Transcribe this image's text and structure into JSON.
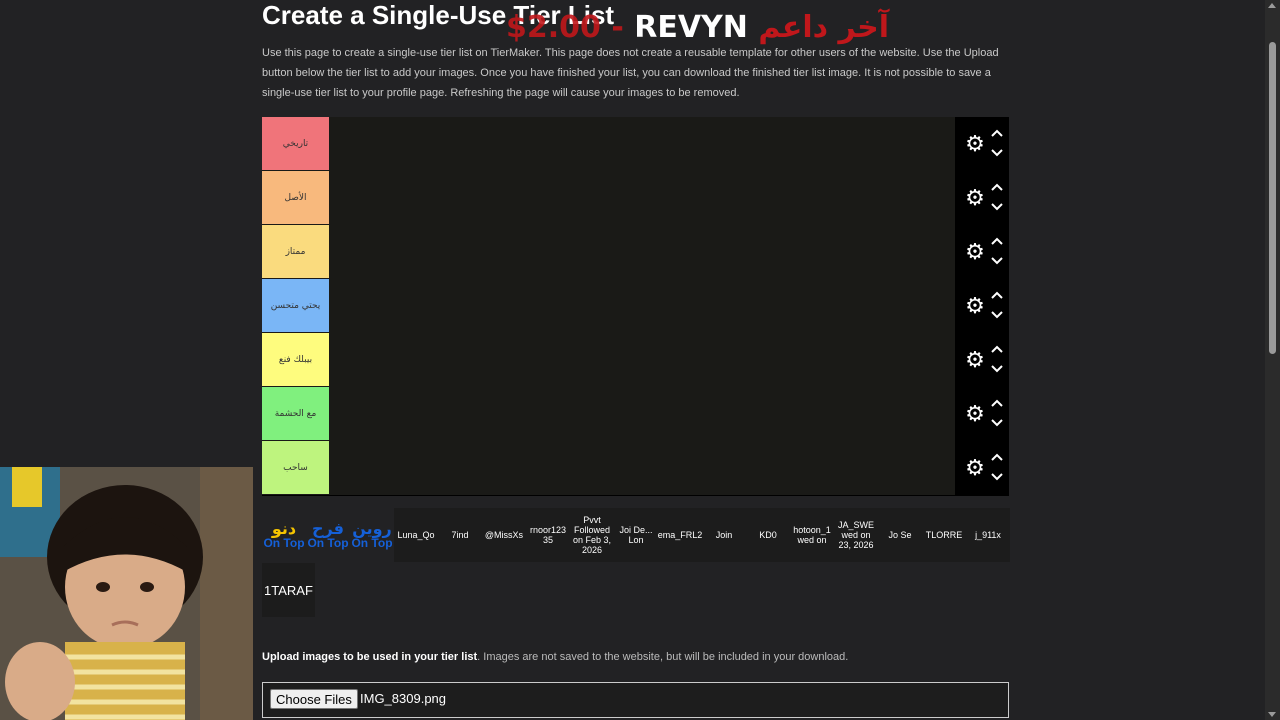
{
  "page": {
    "title": "Create a Single-Use Tier List",
    "intro": "Use this page to create a single-use tier list on TierMaker. This page does not create a reusable template for other users of the website. Use the Upload button below the tier list to add your images. Once you have finished your list, you can download the finished tier list image. It is not possible to save a single-use tier list to your profile page. Refreshing the page will cause your images to be removed."
  },
  "overlay": {
    "price": "$2.00 - ",
    "name": "REVYN",
    "arabic": "آخر داعم"
  },
  "tiers": [
    {
      "label": "تاريخي",
      "color": "#f0747a"
    },
    {
      "label": "الأصل",
      "color": "#f8b97d"
    },
    {
      "label": "ممتاز",
      "color": "#fadb7e"
    },
    {
      "label": "يحتي متحسن",
      "color": "#7ab6f6"
    },
    {
      "label": "بيبلك فنع",
      "color": "#fefc7e"
    },
    {
      "label": "مع الحشمة",
      "color": "#80f07e"
    },
    {
      "label": "ساحب",
      "color": "#bef47e"
    }
  ],
  "pool": [
    {
      "word": "دنو",
      "sub": "On Top",
      "word_color": "#f5c400"
    },
    {
      "word": "فرح",
      "sub": "On Top",
      "word_color": "#1560d8"
    },
    {
      "word": "روين",
      "sub": "On Top",
      "word_color": "#1560d8"
    },
    {
      "text": "Luna_Qo"
    },
    {
      "text": "7ind"
    },
    {
      "text": "@MissXs"
    },
    {
      "text": "rnoor123 35"
    },
    {
      "text": "Pvvt Followed on Feb 3, 2026"
    },
    {
      "text": "Joi De... Lon"
    },
    {
      "text": "eema_FRL21"
    },
    {
      "text": "Join"
    },
    {
      "text": "KD0"
    },
    {
      "text": "hotoon_1 wed on"
    },
    {
      "text": "JA_SWE wed on 23, 2026"
    },
    {
      "text": "Jo Se"
    },
    {
      "text": "TLORRE"
    },
    {
      "text": "j_911x"
    }
  ],
  "extra_item": "1TARAF",
  "upload": {
    "caption_bold": "Upload images to be used in your tier list",
    "caption_rest": ". Images are not saved to the website, but will be included in your download.",
    "button_label": "Choose Files",
    "file_name": "IMG_8309.png"
  },
  "icons": {
    "gear": "gear-icon",
    "up": "chevron-up-icon",
    "down": "chevron-down-icon"
  }
}
